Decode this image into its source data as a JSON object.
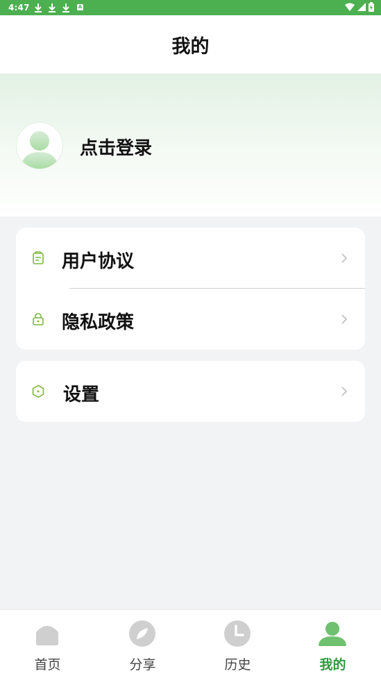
{
  "status_bar": {
    "time": "4:47",
    "badge": "A"
  },
  "header": {
    "title": "我的"
  },
  "profile": {
    "login_text": "点击登录"
  },
  "menu_group_1": [
    {
      "label": "用户协议",
      "icon": "document-icon"
    },
    {
      "label": "隐私政策",
      "icon": "lock-icon"
    }
  ],
  "menu_group_2": [
    {
      "label": "设置",
      "icon": "hexagon-settings-icon"
    }
  ],
  "tabs": [
    {
      "label": "首页",
      "icon": "home-icon",
      "active": false
    },
    {
      "label": "分享",
      "icon": "compass-icon",
      "active": false
    },
    {
      "label": "历史",
      "icon": "clock-icon",
      "active": false
    },
    {
      "label": "我的",
      "icon": "user-icon",
      "active": true
    }
  ],
  "colors": {
    "status_bar": "#4caf50",
    "accent": "#2e9a3e",
    "icon_green": "#7cb83f",
    "inactive_tab_icon": "#cfcfcf"
  }
}
